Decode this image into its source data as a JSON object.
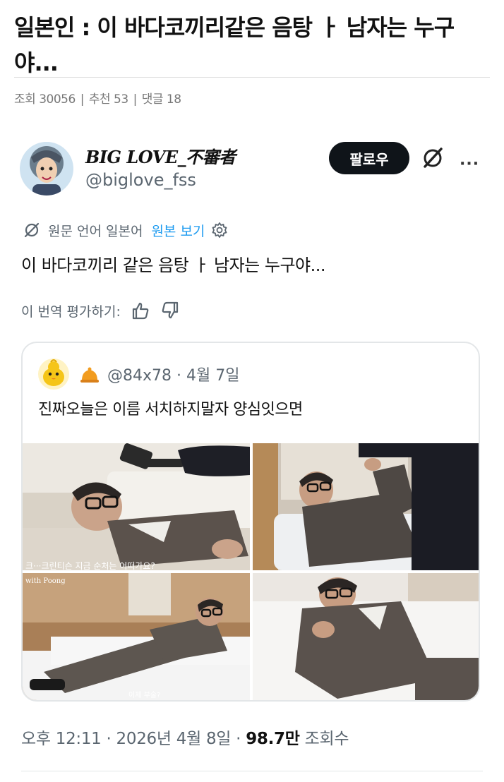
{
  "post": {
    "title": "일본인 : 이 바다코끼리같은 음탕 ㅏ 남자는 누구야...",
    "stats": {
      "views_label": "조회",
      "views": "30056",
      "likes_label": "추천",
      "likes": "53",
      "comments_label": "댓글",
      "comments": "18"
    }
  },
  "tweet": {
    "author_name": "BIG LOVE_不審者",
    "author_handle": "@biglove_fss",
    "follow_label": "팔로우",
    "more_label": "···",
    "translation": {
      "source_label": "원문 언어 일본어",
      "view_original_label": "원본 보기"
    },
    "text": "이 바다코끼리 같은 음탕 ㅏ 남자는 누구야...",
    "rate_label": "이 번역 평가하기:",
    "timestamp": "오후 12:11 · 2026년 4월 8일",
    "view_count": "98.7만",
    "view_count_label": "조회수"
  },
  "quote": {
    "handle": "@84x78",
    "date": "4월 7일",
    "text": "진짜오늘은 이름 서치하지말자 양심잇으면",
    "photos": [
      {
        "caption": "크···크린티슨 지금 순처는 어떠가요?"
      },
      {
        "caption": ""
      },
      {
        "caption": "이제 부술?",
        "watermark": "with Poong"
      },
      {
        "caption": ""
      }
    ]
  },
  "colors": {
    "link": "#1d9bf0",
    "secondary_text": "#5b6670",
    "follow_bg": "#0f1419"
  },
  "icons": [
    "translate-icon",
    "gear-icon",
    "thumbs-up-icon",
    "thumbs-down-icon",
    "grok-icon",
    "more-icon",
    "bell-badge-icon"
  ]
}
